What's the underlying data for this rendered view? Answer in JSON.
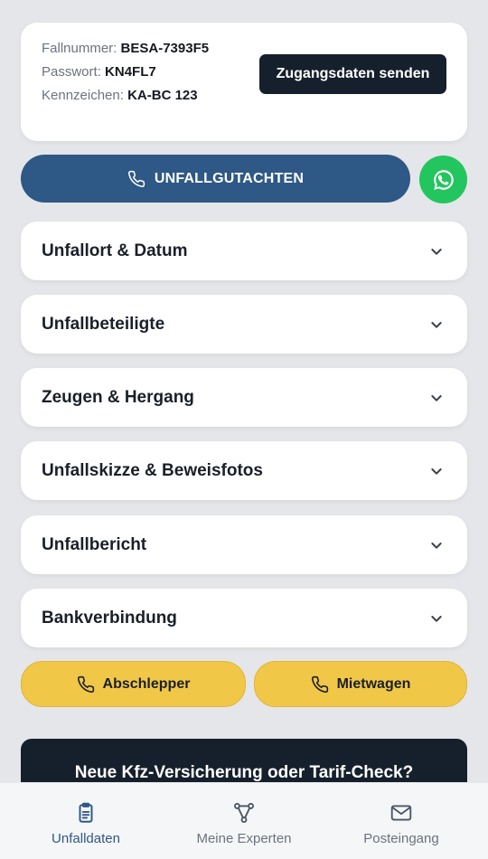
{
  "info": {
    "fallnummer_label": "Fallnummer:",
    "fallnummer_value": "BESA-7393F5",
    "passwort_label": "Passwort:",
    "passwort_value": "KN4FL7",
    "kennzeichen_label": "Kennzeichen:",
    "kennzeichen_value": "KA-BC 123",
    "send_label": "Zugangsdaten senden"
  },
  "main_button": {
    "label": "UNFALLGUTACHTEN",
    "icon": "phone-icon"
  },
  "whatsapp": {
    "icon": "whatsapp-icon",
    "color": "#22c55e"
  },
  "sections": [
    {
      "label": "Unfallort & Datum"
    },
    {
      "label": "Unfallbeteiligte"
    },
    {
      "label": "Zeugen & Hergang"
    },
    {
      "label": "Unfallskizze & Beweisfotos"
    },
    {
      "label": "Unfallbericht"
    },
    {
      "label": "Bankverbindung"
    }
  ],
  "actions": {
    "abschlepper": "Abschlepper",
    "mietwagen": "Mietwagen"
  },
  "promo": {
    "title": "Neue Kfz-Versicherung oder Tarif-Check?"
  },
  "tabs": [
    {
      "label": "Unfalldaten",
      "icon": "clipboard-icon",
      "active": true
    },
    {
      "label": "Meine Experten",
      "icon": "network-icon",
      "active": false
    },
    {
      "label": "Posteingang",
      "icon": "mail-icon",
      "active": false
    }
  ],
  "colors": {
    "primary": "#2e5885",
    "dark": "#16202c",
    "accent_yellow": "#f1c748",
    "background": "#e4e6e9"
  }
}
